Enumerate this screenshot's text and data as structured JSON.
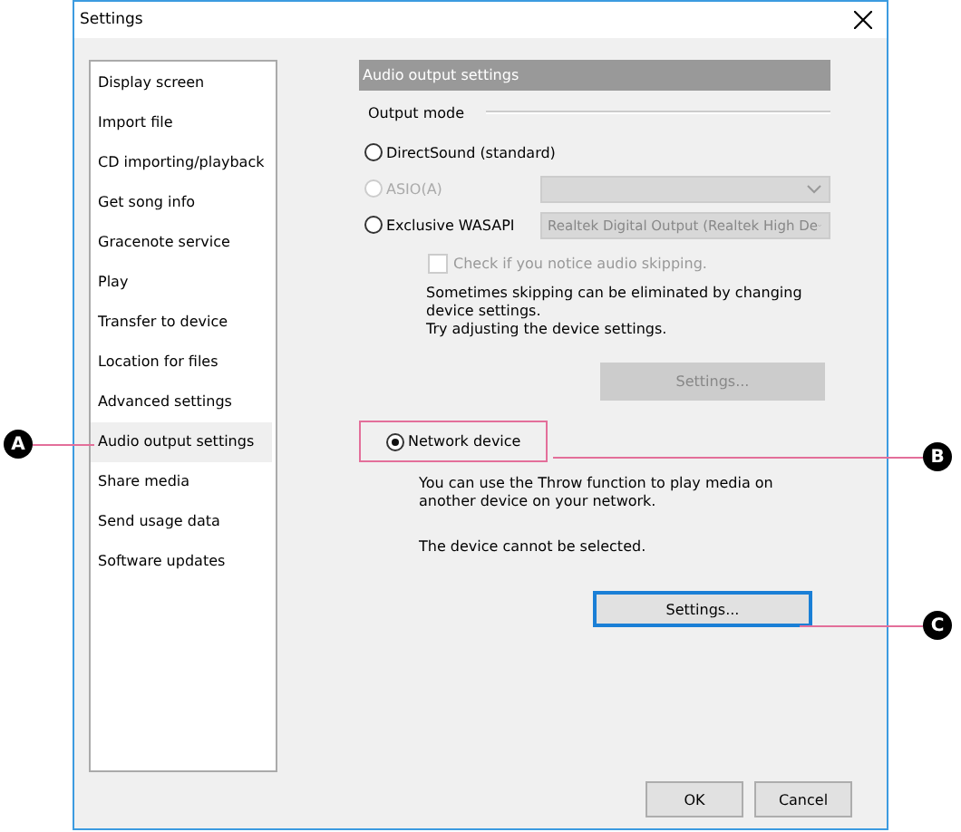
{
  "window": {
    "title": "Settings"
  },
  "sidebar": {
    "items": [
      {
        "label": "Display screen",
        "selected": false
      },
      {
        "label": "Import file",
        "selected": false
      },
      {
        "label": "CD importing/playback",
        "selected": false
      },
      {
        "label": "Get song info",
        "selected": false
      },
      {
        "label": "Gracenote service",
        "selected": false
      },
      {
        "label": "Play",
        "selected": false
      },
      {
        "label": "Transfer to device",
        "selected": false
      },
      {
        "label": "Location for files",
        "selected": false
      },
      {
        "label": "Advanced settings",
        "selected": false
      },
      {
        "label": "Audio output settings",
        "selected": true
      },
      {
        "label": "Share media",
        "selected": false
      },
      {
        "label": "Send usage data",
        "selected": false
      },
      {
        "label": "Software updates",
        "selected": false
      }
    ]
  },
  "panel": {
    "header": "Audio output settings",
    "group_label": "Output mode",
    "output_modes": [
      {
        "label": "DirectSound (standard)",
        "selected": false,
        "disabled": false
      },
      {
        "label": "ASIO(A)",
        "selected": false,
        "disabled": true,
        "dropdown": {
          "disabled": true
        }
      },
      {
        "label": "Exclusive WASAPI",
        "selected": false,
        "disabled": false,
        "dropdown": {
          "value": "Realtek Digital Output (Realtek High De",
          "disabled": true
        }
      }
    ],
    "skip_check": {
      "label": "Check if you notice audio skipping.",
      "checked": false,
      "disabled": true
    },
    "skip_note": [
      "Sometimes skipping can be eliminated by changing device settings.",
      "Try adjusting the device settings."
    ],
    "skip_settings_button": {
      "label": "Settings...",
      "disabled": true
    },
    "network_device": {
      "label": "Network device",
      "selected": true
    },
    "network_note": "You can use the Throw function to play media on another device on your network.",
    "network_status": "The device cannot be selected.",
    "network_settings_button": {
      "label": "Settings...",
      "disabled": false,
      "focused": true
    }
  },
  "buttons": [
    "OK",
    "Cancel"
  ],
  "callouts": [
    {
      "letter": "A"
    },
    {
      "letter": "B"
    },
    {
      "letter": "C"
    }
  ]
}
